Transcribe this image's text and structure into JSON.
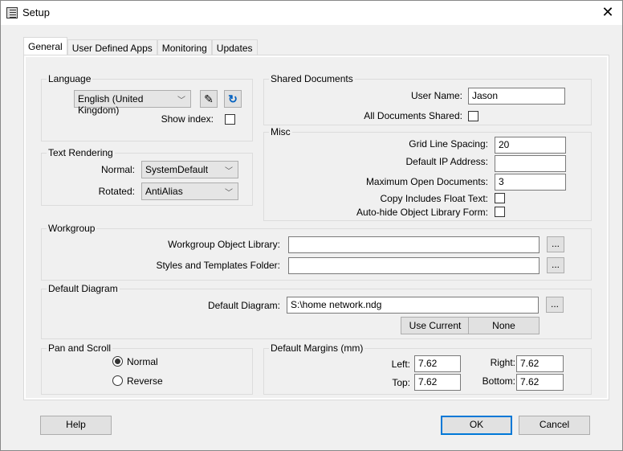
{
  "window": {
    "title": "Setup"
  },
  "tabs": [
    {
      "label": "General"
    },
    {
      "label": "User Defined Apps"
    },
    {
      "label": "Monitoring"
    },
    {
      "label": "Updates"
    }
  ],
  "language": {
    "title": "Language",
    "selected": "English (United Kingdom)",
    "show_index_label": "Show index:",
    "show_index": false
  },
  "text_rendering": {
    "title": "Text Rendering",
    "normal_label": "Normal:",
    "normal_value": "SystemDefault",
    "rotated_label": "Rotated:",
    "rotated_value": "AntiAlias"
  },
  "shared": {
    "title": "Shared Documents",
    "user_name_label": "User Name:",
    "user_name": "Jason",
    "all_shared_label": "All Documents Shared:",
    "all_shared": false
  },
  "misc": {
    "title": "Misc",
    "grid_label": "Grid Line Spacing:",
    "grid_value": "20",
    "ip_label": "Default IP Address:",
    "ip_value": "",
    "max_docs_label": "Maximum Open Documents:",
    "max_docs_value": "3",
    "copy_float_label": "Copy Includes Float Text:",
    "autohide_label": "Auto-hide Object Library Form:"
  },
  "workgroup": {
    "title": "Workgroup",
    "library_label": "Workgroup Object Library:",
    "library_value": "",
    "styles_label": "Styles and Templates Folder:",
    "styles_value": "",
    "browse_label": "..."
  },
  "default_diagram": {
    "title": "Default Diagram",
    "label": "Default Diagram:",
    "value": "S:\\home network.ndg",
    "use_current": "Use Current",
    "none": "None"
  },
  "pan_scroll": {
    "title": "Pan and Scroll",
    "normal": "Normal",
    "reverse": "Reverse",
    "selected": "Normal"
  },
  "margins": {
    "title": "Default Margins (mm)",
    "left_label": "Left:",
    "left": "7.62",
    "right_label": "Right:",
    "right": "7.62",
    "top_label": "Top:",
    "top": "7.62",
    "bottom_label": "Bottom:",
    "bottom": "7.62"
  },
  "buttons": {
    "help": "Help",
    "ok": "OK",
    "cancel": "Cancel"
  }
}
